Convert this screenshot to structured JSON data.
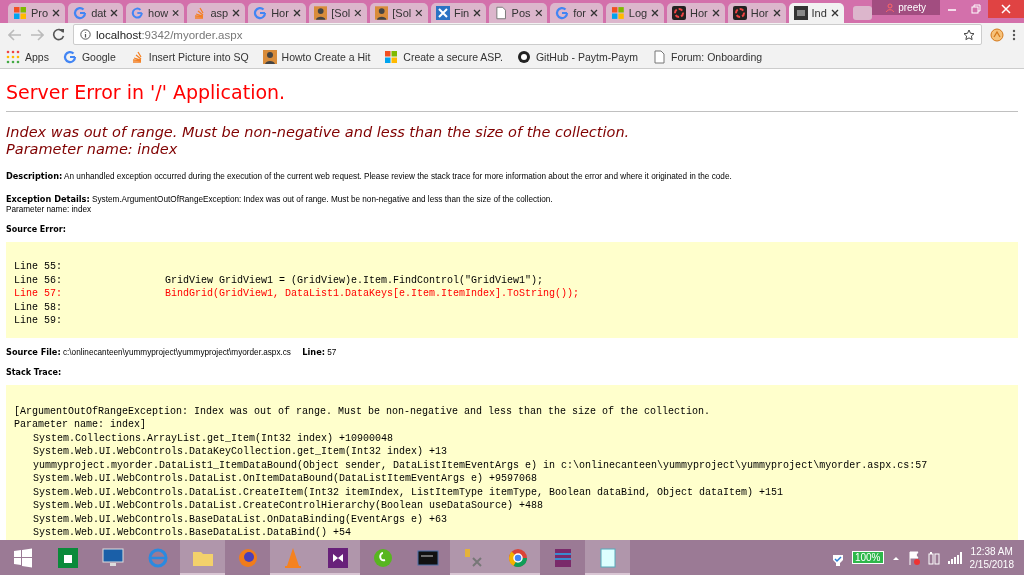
{
  "browser": {
    "tabs": [
      {
        "label": "Pro",
        "kind": "squares",
        "selected": false
      },
      {
        "label": "dat",
        "kind": "g",
        "selected": false
      },
      {
        "label": "how",
        "kind": "g",
        "selected": false
      },
      {
        "label": "asp",
        "kind": "stack",
        "selected": false
      },
      {
        "label": "Hor",
        "kind": "g",
        "selected": false
      },
      {
        "label": "[Sol",
        "kind": "avatar",
        "selected": false
      },
      {
        "label": "[Sol",
        "kind": "avatar",
        "selected": false
      },
      {
        "label": "Fin",
        "kind": "cross",
        "selected": false
      },
      {
        "label": "Pos",
        "kind": "doc",
        "selected": false
      },
      {
        "label": "for",
        "kind": "g",
        "selected": false
      },
      {
        "label": "Log",
        "kind": "squares",
        "selected": false
      },
      {
        "label": "Hor",
        "kind": "swirl",
        "selected": false
      },
      {
        "label": "Hor",
        "kind": "swirl",
        "selected": false
      },
      {
        "label": "Ind",
        "kind": "dark",
        "selected": true
      }
    ],
    "profile": "preety",
    "address": {
      "host": "localhost",
      "path": ":9342/myorder.aspx"
    },
    "bookmarks": [
      {
        "label": "Apps",
        "kind": "grid"
      },
      {
        "label": "Google",
        "kind": "g"
      },
      {
        "label": "Insert Picture into SQ",
        "kind": "stack"
      },
      {
        "label": "Howto Create a Hit",
        "kind": "avatar"
      },
      {
        "label": "Create a secure ASP.",
        "kind": "squares"
      },
      {
        "label": "GitHub - Paytm-Paym",
        "kind": "cat"
      },
      {
        "label": "Forum: Onboarding",
        "kind": "doc"
      }
    ]
  },
  "page": {
    "title": "Server Error in '/' Application.",
    "message": [
      "Index was out of range. Must be non-negative and less than the size of the collection.",
      "Parameter name: index"
    ],
    "description": "**Description:** An unhandled exception occurred during the execution of the current web request. Please review the stack trace for more information about the error and where it originated in the code.",
    "exception_details": [
      "**Exception Details:** System.ArgumentOutOfRangeException: Index was out of range. Must be non-negative and less than the size of the collection.",
      "Parameter name: index"
    ],
    "source_error_label": "Source Error:",
    "source_lines": [
      {
        "number": "Line 55:",
        "highlighted": false
      },
      {
        "number": "Line 56:",
        "code": "GridView GridView1 = (GridView)e.Item.FindControl(\"GridView1\");",
        "highlighted": false
      },
      {
        "number": "Line 57:",
        "code": "BindGrid(GridView1, DataList1.DataKeys[e.Item.ItemIndex].ToString());",
        "highlighted": true
      },
      {
        "number": "Line 58:",
        "highlighted": false
      },
      {
        "number": "Line 59:",
        "highlighted": false
      }
    ],
    "source_file": "**Source File:** c:\\onlinecanteen\\yummyproject\\yummyproject\\myorder.aspx.cs    **Line:** 57",
    "stack_trace_label": "Stack Trace:",
    "stack_lines": [
      {
        "kind": "message",
        "text": "[ArgumentOutOfRangeException: Index was out of range. Must be non-negative and less than the size of the collection."
      },
      {
        "kind": "message",
        "text": "Parameter name: index]"
      },
      {
        "kind": "frame",
        "text": "System.Collections.ArrayList.get_Item(Int32 index) +10900048"
      },
      {
        "kind": "frame",
        "text": "System.Web.UI.WebControls.DataKeyCollection.get_Item(Int32 index) +13"
      },
      {
        "kind": "frame",
        "text": "yummyproject.myorder.DataList1_ItemDataBound(Object sender, DataListItemEventArgs e) in c:\\onlinecanteen\\yummyproject\\yummyproject\\myorder.aspx.cs:57"
      },
      {
        "kind": "frame",
        "text": "System.Web.UI.WebControls.DataList.OnItemDataBound(DataListItemEventArgs e) +9597068"
      },
      {
        "kind": "frame",
        "text": "System.Web.UI.WebControls.DataList.CreateItem(Int32 itemIndex, ListItemType itemType, Boolean dataBind, Object dataItem) +151"
      },
      {
        "kind": "frame",
        "text": "System.Web.UI.WebControls.DataList.CreateControlHierarchy(Boolean useDataSource) +488"
      },
      {
        "kind": "frame",
        "text": "System.Web.UI.WebControls.BaseDataList.OnDataBinding(EventArgs e) +63"
      },
      {
        "kind": "frame",
        "text": "System.Web.UI.WebControls.BaseDataList.DataBind() +54"
      }
    ]
  },
  "taskbar": {
    "apps": [
      {
        "kind": "store",
        "running": false
      },
      {
        "kind": "monitor",
        "running": false
      },
      {
        "kind": "ie",
        "running": false
      },
      {
        "kind": "folder",
        "running": true
      },
      {
        "kind": "fox",
        "running": false
      },
      {
        "kind": "cone",
        "running": true
      },
      {
        "kind": "vs",
        "running": true
      },
      {
        "kind": "dw",
        "running": false
      },
      {
        "kind": "terminal",
        "running": false
      },
      {
        "kind": "tools",
        "running": true
      },
      {
        "kind": "chrome",
        "running": true
      },
      {
        "kind": "archive",
        "running": false
      },
      {
        "kind": "notepad",
        "running": true
      }
    ],
    "battery": "100%",
    "time": "12:38 AM",
    "date": "2/15/2018"
  }
}
